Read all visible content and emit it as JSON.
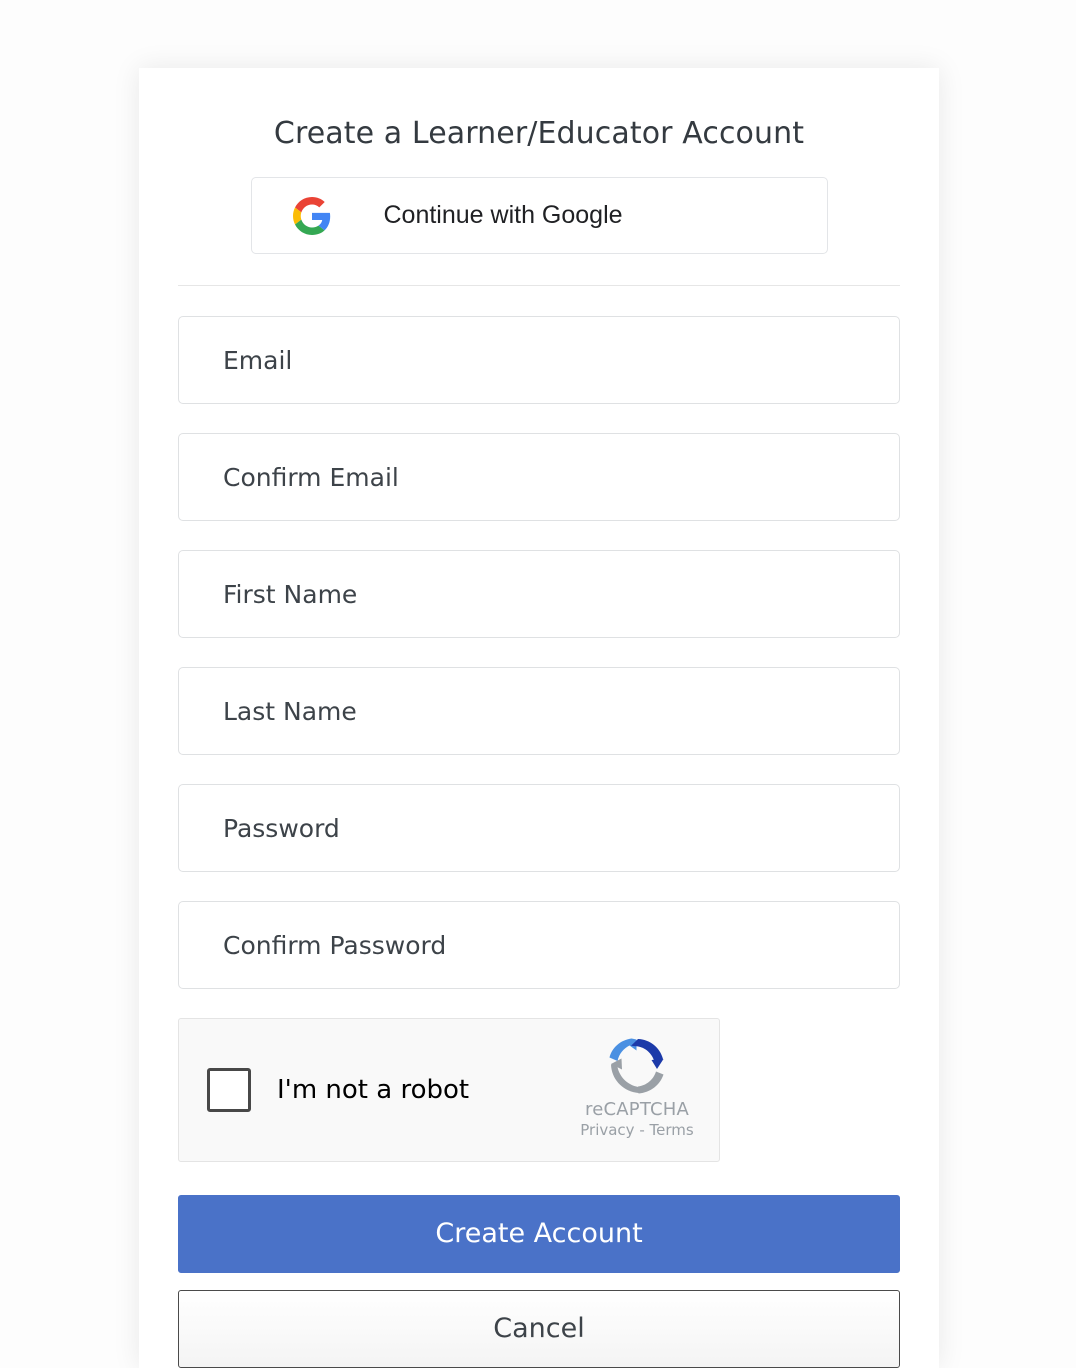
{
  "page": {
    "title": "Create a Learner/Educator Account",
    "background_color": "#fdfdfd",
    "card_background": "#ffffff"
  },
  "social": {
    "google_button_label": "Continue with Google",
    "google_icon": "google-g-icon",
    "google_colors": {
      "red": "#EA4335",
      "yellow": "#FBBC05",
      "green": "#34A853",
      "blue": "#4285F4"
    }
  },
  "form": {
    "fields": [
      {
        "name": "email",
        "placeholder": "Email",
        "value": "",
        "type": "email"
      },
      {
        "name": "confirm-email",
        "placeholder": "Confirm Email",
        "value": "",
        "type": "email"
      },
      {
        "name": "first-name",
        "placeholder": "First Name",
        "value": "",
        "type": "text"
      },
      {
        "name": "last-name",
        "placeholder": "Last Name",
        "value": "",
        "type": "text"
      },
      {
        "name": "password",
        "placeholder": "Password",
        "value": "",
        "type": "password"
      },
      {
        "name": "confirm-password",
        "placeholder": "Confirm Password",
        "value": "",
        "type": "password"
      }
    ]
  },
  "recaptcha": {
    "checkbox_label": "I'm not a robot",
    "checked": false,
    "brand_name": "reCAPTCHA",
    "privacy_label": "Privacy",
    "separator": "-",
    "terms_label": "Terms",
    "logo_icon": "recaptcha-circular-arrows-icon",
    "logo_colors": {
      "light_blue": "#4a90e2",
      "dark_blue": "#1c3aa9",
      "gray": "#9aa0a6"
    },
    "background_color": "#f9f9f9"
  },
  "actions": {
    "submit_label": "Create Account",
    "submit_color": "#4a72c8",
    "cancel_label": "Cancel"
  }
}
